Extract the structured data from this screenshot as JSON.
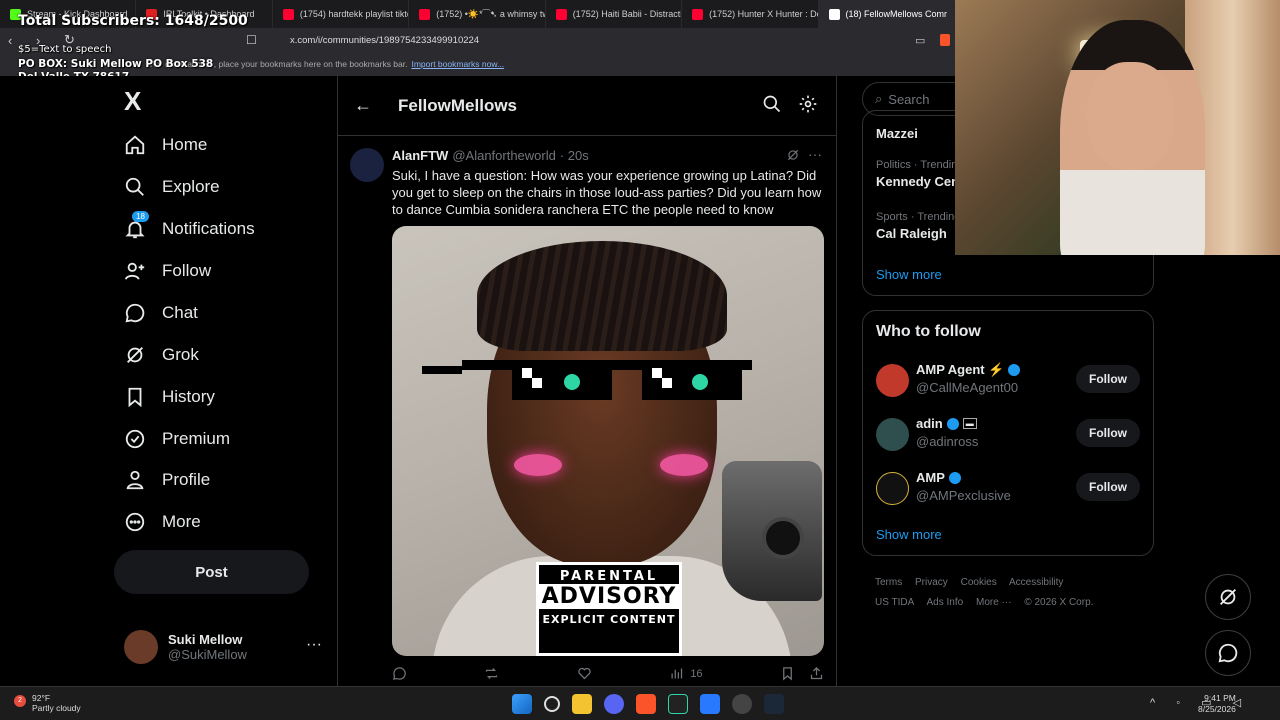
{
  "browser": {
    "tabs": [
      {
        "label": "Stream - Kick Dashboard",
        "color": "#53fc18"
      },
      {
        "label": "IRLToolkit • Dashboard",
        "color": "#e02020"
      },
      {
        "label": "(1754) hardtekk playlist tiktok",
        "color": "#ff0033"
      },
      {
        "label": "(1752) •☀️*⁀➷ a whimsy tw",
        "color": "#ff0033"
      },
      {
        "label": "(1752) Haiti Babii - Distraction",
        "color": "#ff0033"
      },
      {
        "label": "(1752) Hunter X Hunter : Depar",
        "color": "#ff0033"
      },
      {
        "label": "(18) FellowMellows Comr",
        "color": "#ffffff"
      }
    ],
    "url": "x.com/i/communities/1989754233499910224",
    "bookmarks_hint": "For quick access, place your bookmarks here on the bookmarks bar.",
    "import_link": "Import bookmarks now..."
  },
  "overlay": {
    "subscribers": "Total Subscribers: 1648/2500",
    "tts": "$5=Text to speech",
    "pobox_line1": "PO BOX: Suki Mellow PO Box 538",
    "pobox_line2": "Del Valle TX 78617"
  },
  "nav": {
    "logo": "X",
    "items": [
      {
        "label": "Home",
        "icon": "home-icon"
      },
      {
        "label": "Explore",
        "icon": "search-icon"
      },
      {
        "label": "Notifications",
        "icon": "bell-icon",
        "badge": "18"
      },
      {
        "label": "Follow",
        "icon": "add-user-icon"
      },
      {
        "label": "Chat",
        "icon": "chat-icon"
      },
      {
        "label": "Grok",
        "icon": "grok-icon"
      },
      {
        "label": "History",
        "icon": "bookmark-icon"
      },
      {
        "label": "Premium",
        "icon": "verified-icon"
      },
      {
        "label": "Profile",
        "icon": "person-icon"
      },
      {
        "label": "More",
        "icon": "more-circle-icon"
      }
    ],
    "post_label": "Post",
    "user": {
      "name": "Suki Mellow",
      "handle": "@SukiMellow"
    }
  },
  "feed": {
    "title": "FellowMellows",
    "tweet": {
      "name": "AlanFTW",
      "handle": "@Alanfortheworld",
      "time": "· 20s",
      "text": "Suki, I have a question: How was your experience growing up Latina? Did you get to sleep on the chairs in those loud-ass parties? Did you learn how to dance Cumbia sonidera ranchera ETC the people need to know",
      "views": "16",
      "advisory": {
        "line1": "PARENTAL",
        "line2": "ADVISORY",
        "line3": "EXPLICIT CONTENT"
      }
    }
  },
  "sidebar": {
    "search_placeholder": "Search",
    "trends": [
      {
        "category": "",
        "title": "Mazzei"
      },
      {
        "category": "Politics · Trending",
        "title": "Kennedy Center"
      },
      {
        "category": "Sports · Trending",
        "title": "Cal Raleigh"
      }
    ],
    "trends_show_more": "Show more",
    "who_to_follow": {
      "title": "Who to follow",
      "accounts": [
        {
          "name": "AMP Agent ⚡",
          "handle": "@CallMeAgent00",
          "button": "Follow",
          "avatar_color": "#c0392b"
        },
        {
          "name": "adin",
          "handle": "@adinross",
          "button": "Follow",
          "avatar_color": "#2f4f4f"
        },
        {
          "name": "AMP",
          "handle": "@AMPexclusive",
          "button": "Follow",
          "avatar_color": "#111111"
        }
      ],
      "show_more": "Show more"
    },
    "footer": [
      "Terms",
      "Privacy",
      "Cookies",
      "Accessibility",
      "US TIDA",
      "Ads Info",
      "More ···",
      "© 2026 X Corp."
    ]
  },
  "taskbar": {
    "temp": "92°F",
    "weather": "Partly cloudy",
    "weather_badge": "2",
    "time": "9:41 PM",
    "date": "8/25/2026"
  },
  "colors": {
    "accent": "#1d9bf0",
    "bg": "#000000",
    "border": "#2f3336",
    "muted": "#71767b"
  }
}
